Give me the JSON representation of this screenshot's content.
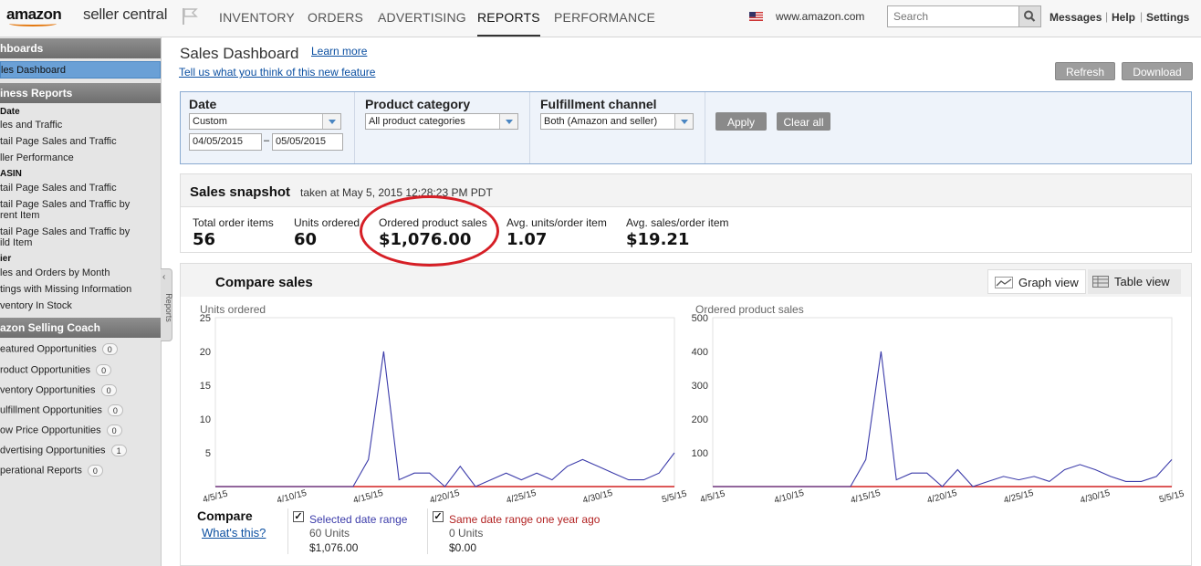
{
  "topnav": {
    "logo_brand": "amazon",
    "logo_product": "seller central",
    "tabs": [
      {
        "label": "INVENTORY",
        "active": false
      },
      {
        "label": "ORDERS",
        "active": false
      },
      {
        "label": "ADVERTISING",
        "active": false
      },
      {
        "label": "REPORTS",
        "active": true
      },
      {
        "label": "PERFORMANCE",
        "active": false
      }
    ],
    "marketplace": "www.amazon.com",
    "search_placeholder": "Search",
    "links": [
      "Messages",
      "Help",
      "Settings"
    ]
  },
  "sidebar": {
    "sections": [
      {
        "title": "hboards",
        "items": [
          {
            "label": "les Dashboard",
            "selected": true
          }
        ]
      },
      {
        "title": "iness Reports",
        "groups": [
          {
            "subtitle": "Date",
            "items": [
              "les and Traffic",
              "tail Page Sales and Traffic",
              "ller Performance"
            ]
          },
          {
            "subtitle": "ASIN",
            "items": [
              "tail Page Sales and Traffic",
              "tail Page Sales and Traffic by",
              "rent Item",
              "tail Page Sales and Traffic by",
              "ild Item"
            ]
          },
          {
            "subtitle": "ier",
            "items": [
              "les and Orders by Month",
              "tings with Missing Information",
              "ventory In Stock"
            ]
          }
        ]
      },
      {
        "title": "azon Selling Coach",
        "items": [
          {
            "label": "eatured Opportunities",
            "count": "0"
          },
          {
            "label": "roduct Opportunities",
            "count": "0"
          },
          {
            "label": "ventory Opportunities",
            "count": "0"
          },
          {
            "label": "ulfillment Opportunities",
            "count": "0"
          },
          {
            "label": "ow Price Opportunities",
            "count": "0"
          },
          {
            "label": "dvertising Opportunities",
            "count": "1"
          },
          {
            "label": "perational Reports",
            "count": "0"
          }
        ]
      }
    ],
    "collapse_label": "Reports"
  },
  "page": {
    "title": "Sales Dashboard",
    "learn_more": "Learn more",
    "feedback_link": "Tell us what you think of this new feature",
    "refresh": "Refresh",
    "download": "Download"
  },
  "filters": {
    "date_label": "Date",
    "date_option": "Custom",
    "date_from": "04/05/2015",
    "date_sep": "–",
    "date_to": "05/05/2015",
    "category_label": "Product category",
    "category_option": "All product categories",
    "channel_label": "Fulfillment channel",
    "channel_option": "Both (Amazon and seller)",
    "apply": "Apply",
    "clear": "Clear all"
  },
  "snapshot": {
    "title": "Sales snapshot",
    "subtitle": "taken at May 5, 2015 12:28:23 PM PDT",
    "metrics": [
      {
        "label": "Total order items",
        "value": "56"
      },
      {
        "label": "Units ordered",
        "value": "60"
      },
      {
        "label": "Ordered product sales",
        "value": "$1,076.00"
      },
      {
        "label": "Avg. units/order item",
        "value": "1.07"
      },
      {
        "label": "Avg. sales/order item",
        "value": "$19.21"
      }
    ]
  },
  "compare": {
    "title": "Compare sales",
    "graph_view": "Graph view",
    "table_view": "Table view",
    "compare_label": "Compare",
    "whats_this": "What's this?",
    "legend": [
      {
        "label": "Selected date range",
        "units": "60 Units",
        "sales": "$1,076.00",
        "color": "#3c3caa"
      },
      {
        "label": "Same date range one year ago",
        "units": "0 Units",
        "sales": "$0.00",
        "color": "#b22222"
      }
    ]
  },
  "chart_data": [
    {
      "type": "line",
      "ylabel": "Units ordered",
      "ylim": [
        0,
        25
      ],
      "yticks": [
        5,
        10,
        15,
        20,
        25
      ],
      "x": [
        "4/5/15",
        "4/6/15",
        "4/7/15",
        "4/8/15",
        "4/9/15",
        "4/10/15",
        "4/11/15",
        "4/12/15",
        "4/13/15",
        "4/14/15",
        "4/15/15",
        "4/16/15",
        "4/17/15",
        "4/18/15",
        "4/19/15",
        "4/20/15",
        "4/21/15",
        "4/22/15",
        "4/23/15",
        "4/24/15",
        "4/25/15",
        "4/26/15",
        "4/27/15",
        "4/28/15",
        "4/29/15",
        "4/30/15",
        "5/1/15",
        "5/2/15",
        "5/3/15",
        "5/4/15",
        "5/5/15"
      ],
      "xtick_labels": [
        "4/5/15",
        "4/10/15",
        "4/15/15",
        "4/20/15",
        "4/25/15",
        "4/30/15",
        "5/5/15"
      ],
      "series": [
        {
          "name": "Selected date range",
          "color": "#3c3caa",
          "values": [
            0,
            0,
            0,
            0,
            0,
            0,
            0,
            0,
            0,
            0,
            4,
            20,
            1,
            2,
            2,
            0,
            3,
            0,
            1,
            2,
            1,
            2,
            1,
            3,
            4,
            3,
            2,
            1,
            1,
            2,
            5
          ]
        },
        {
          "name": "Same date range one year ago",
          "color": "#d22020",
          "values": [
            0,
            0,
            0,
            0,
            0,
            0,
            0,
            0,
            0,
            0,
            0,
            0,
            0,
            0,
            0,
            0,
            0,
            0,
            0,
            0,
            0,
            0,
            0,
            0,
            0,
            0,
            0,
            0,
            0,
            0,
            0
          ]
        }
      ]
    },
    {
      "type": "line",
      "ylabel": "Ordered product sales",
      "ylim": [
        0,
        500
      ],
      "yticks": [
        100,
        200,
        300,
        400,
        500
      ],
      "x": [
        "4/5/15",
        "4/6/15",
        "4/7/15",
        "4/8/15",
        "4/9/15",
        "4/10/15",
        "4/11/15",
        "4/12/15",
        "4/13/15",
        "4/14/15",
        "4/15/15",
        "4/16/15",
        "4/17/15",
        "4/18/15",
        "4/19/15",
        "4/20/15",
        "4/21/15",
        "4/22/15",
        "4/23/15",
        "4/24/15",
        "4/25/15",
        "4/26/15",
        "4/27/15",
        "4/28/15",
        "4/29/15",
        "4/30/15",
        "5/1/15",
        "5/2/15",
        "5/3/15",
        "5/4/15",
        "5/5/15"
      ],
      "xtick_labels": [
        "4/5/15",
        "4/10/15",
        "4/15/15",
        "4/20/15",
        "4/25/15",
        "4/30/15",
        "5/5/15"
      ],
      "series": [
        {
          "name": "Selected date range",
          "color": "#3c3caa",
          "values": [
            0,
            0,
            0,
            0,
            0,
            0,
            0,
            0,
            0,
            0,
            80,
            400,
            20,
            40,
            40,
            0,
            50,
            0,
            15,
            30,
            20,
            30,
            15,
            50,
            65,
            50,
            30,
            15,
            15,
            30,
            80
          ]
        },
        {
          "name": "Same date range one year ago",
          "color": "#d22020",
          "values": [
            0,
            0,
            0,
            0,
            0,
            0,
            0,
            0,
            0,
            0,
            0,
            0,
            0,
            0,
            0,
            0,
            0,
            0,
            0,
            0,
            0,
            0,
            0,
            0,
            0,
            0,
            0,
            0,
            0,
            0,
            0
          ]
        }
      ]
    }
  ]
}
